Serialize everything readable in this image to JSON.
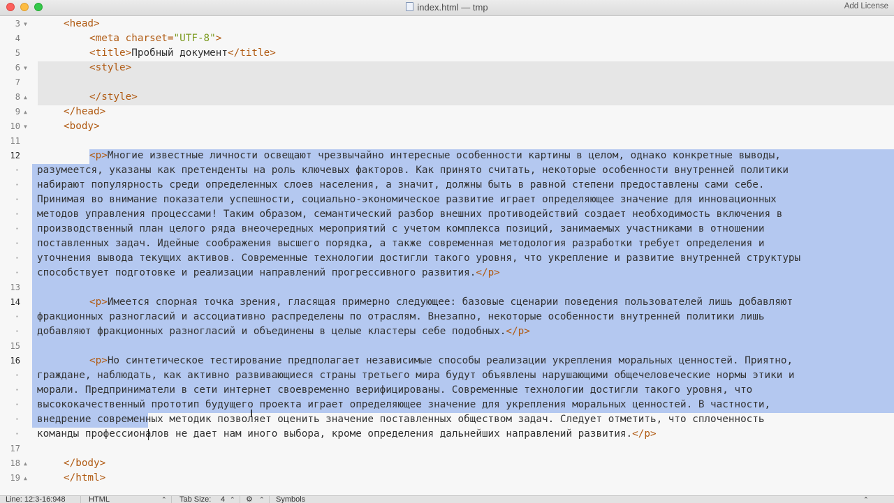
{
  "window": {
    "title": "index.html — tmp",
    "license_label": "Add License"
  },
  "editor": {
    "lines": [
      {
        "num": "3",
        "t": [
          [
            "tag",
            "<head>"
          ]
        ]
      },
      {
        "num": "4",
        "t": [
          [
            "tag",
            "<meta charset="
          ],
          [
            "str",
            "\"UTF-8\""
          ],
          [
            "tag",
            ">"
          ]
        ]
      },
      {
        "num": "5",
        "t": [
          [
            "tag",
            "<title>"
          ],
          [
            "txt",
            "Пробный документ"
          ],
          [
            "tag",
            "</title>"
          ]
        ]
      },
      {
        "num": "6",
        "t": [
          [
            "tag",
            "<style>"
          ]
        ]
      },
      {
        "num": "7",
        "t": []
      },
      {
        "num": "8",
        "t": [
          [
            "tag",
            "</style>"
          ]
        ]
      },
      {
        "num": "9",
        "t": [
          [
            "tag",
            "</head>"
          ]
        ]
      },
      {
        "num": "10",
        "t": [
          [
            "tag",
            "<body>"
          ]
        ]
      },
      {
        "num": "11",
        "t": []
      },
      {
        "num": "12",
        "t": [
          [
            "tag",
            "<p>"
          ],
          [
            "txt",
            "Многие известные личности освещают чрезвычайно интересные особенности картины в целом, однако конкретные выводы,"
          ]
        ]
      },
      {
        "num": "·",
        "t": [
          [
            "txt",
            "разумеется, указаны как претенденты на роль ключевых факторов. Как принято считать, некоторые особенности внутренней политики"
          ]
        ]
      },
      {
        "num": "·",
        "t": [
          [
            "txt",
            "набирают популярность среди определенных слоев населения, а значит, должны быть в равной степени предоставлены сами себе."
          ]
        ]
      },
      {
        "num": "·",
        "t": [
          [
            "txt",
            "Принимая во внимание показатели успешности, социально-экономическое развитие играет определяющее значение для инновационных"
          ]
        ]
      },
      {
        "num": "·",
        "t": [
          [
            "txt",
            "методов управления процессами! Таким образом, семантический разбор внешних противодействий создает необходимость включения в"
          ]
        ]
      },
      {
        "num": "·",
        "t": [
          [
            "txt",
            "производственный план целого ряда внеочередных мероприятий с учетом комплекса позиций, занимаемых участниками в отношении"
          ]
        ]
      },
      {
        "num": "·",
        "t": [
          [
            "txt",
            "поставленных задач. Идейные соображения высшего порядка, а также современная методология разработки требует определения и"
          ]
        ]
      },
      {
        "num": "·",
        "t": [
          [
            "txt",
            "уточнения вывода текущих активов. Современные технологии достигли такого уровня, что укрепление и развитие внутренней структуры"
          ]
        ]
      },
      {
        "num": "·",
        "t": [
          [
            "txt",
            "способствует подготовке и реализации направлений прогрессивного развития."
          ],
          [
            "tag",
            "</p>"
          ]
        ]
      },
      {
        "num": "13",
        "t": []
      },
      {
        "num": "14",
        "t": [
          [
            "tag",
            "<p>"
          ],
          [
            "txt",
            "Имеется спорная точка зрения, гласящая примерно следующее: базовые сценарии поведения пользователей лишь добавляют"
          ]
        ]
      },
      {
        "num": "·",
        "t": [
          [
            "txt",
            "фракционных разногласий и ассоциативно распределены по отраслям. Внезапно, некоторые особенности внутренней политики лишь"
          ]
        ]
      },
      {
        "num": "·",
        "t": [
          [
            "txt",
            "добавляют фракционных разногласий и объединены в целые кластеры себе подобных."
          ],
          [
            "tag",
            "</p>"
          ]
        ]
      },
      {
        "num": "15",
        "t": []
      },
      {
        "num": "16",
        "t": [
          [
            "tag",
            "<p>"
          ],
          [
            "txt",
            "Но синтетическое тестирование предполагает независимые способы реализации укрепления моральных ценностей. Приятно,"
          ]
        ]
      },
      {
        "num": "·",
        "t": [
          [
            "txt",
            "граждане, наблюдать, как активно развивающиеся страны третьего мира будут объявлены нарушающими общечеловеческие нормы этики и"
          ]
        ]
      },
      {
        "num": "·",
        "t": [
          [
            "txt",
            "морали. Предприниматели в сети интернет своевременно верифицированы. Современные технологии достигли такого уровня, что"
          ]
        ]
      },
      {
        "num": "·",
        "t": [
          [
            "txt",
            "высококачественный прототип будущего проекта играет определяющее значение для укрепления моральных ценностей. В частности,"
          ]
        ]
      },
      {
        "num": "·",
        "t": [
          [
            "txt",
            "внедрение современных методик позволяет оценить значение поставленных обществом задач. Следует отметить, что сплоченность"
          ]
        ]
      },
      {
        "num": "·",
        "t": [
          [
            "txt",
            "команды профессионалов не дает нам иного выбора, кроме определения дальнейших направлений развития."
          ],
          [
            "tag",
            "</p>"
          ]
        ]
      },
      {
        "num": "17",
        "t": []
      },
      {
        "num": "18",
        "t": [
          [
            "tag",
            "</body>"
          ]
        ]
      },
      {
        "num": "19",
        "t": [
          [
            "tag",
            "</html>"
          ]
        ]
      }
    ]
  },
  "statusbar": {
    "position": "Line: 12:3-16:948",
    "syntax": "HTML",
    "tab_size_label": "Tab Size:",
    "tab_size_value": "4",
    "symbols_label": "Symbols"
  }
}
